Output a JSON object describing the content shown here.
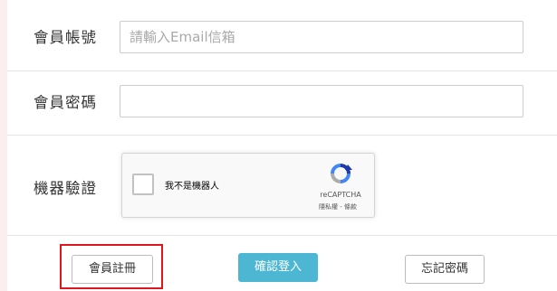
{
  "form": {
    "account": {
      "label": "會員帳號",
      "placeholder": "請輸入Email信箱",
      "value": ""
    },
    "password": {
      "label": "會員密碼",
      "value": ""
    },
    "captcha": {
      "label": "機器驗證",
      "checkbox_text": "我不是機器人",
      "checked": false,
      "brand": "reCAPTCHA",
      "terms": "隱私權 - 條款"
    }
  },
  "buttons": {
    "register": "會員註冊",
    "login": "確認登入",
    "forgot": "忘記密碼"
  },
  "colors": {
    "accent": "#4db7d3",
    "highlight": "#e0161e"
  }
}
